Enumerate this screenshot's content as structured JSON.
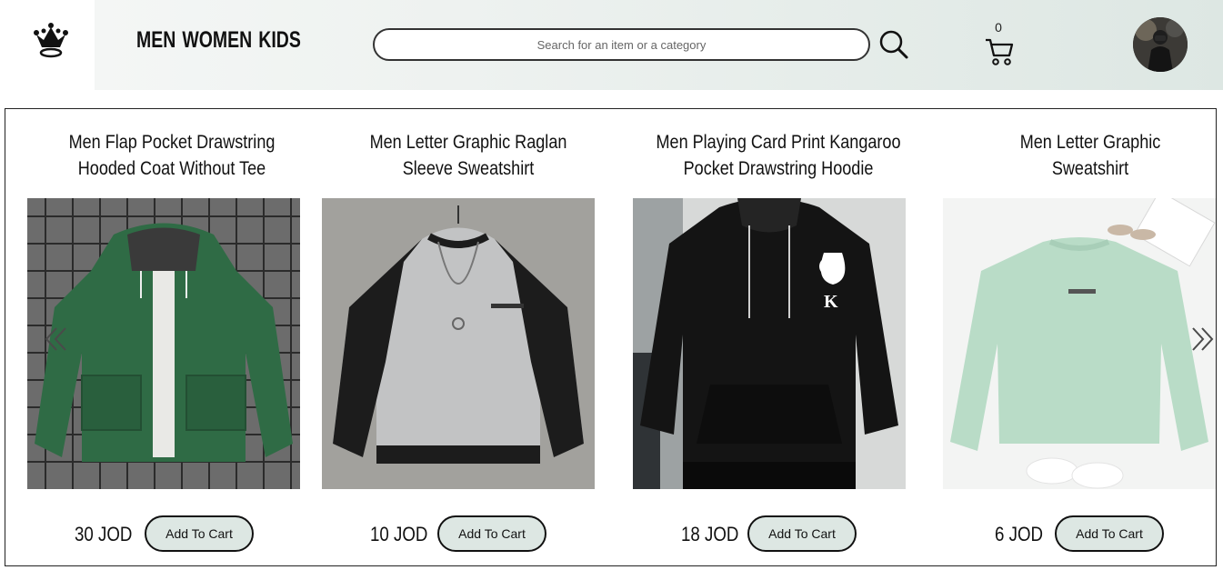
{
  "header": {
    "logo_icon": "crown-icon",
    "nav": [
      "MEN",
      "WOMEN",
      "KIDS"
    ],
    "search": {
      "placeholder": "Search for an item or a category",
      "value": ""
    },
    "search_icon": "search-icon",
    "cart": {
      "count": "0",
      "icon": "cart-icon"
    },
    "avatar_icon": "profile-avatar"
  },
  "carousel": {
    "prev_icon": "chevron-double-left-icon",
    "next_icon": "chevron-double-right-icon",
    "products": [
      {
        "title": "Men Flap Pocket Drawstring Hooded Coat Without Tee",
        "price": "30 JOD",
        "button": "Add To Cart",
        "image": "green-hooded-coat",
        "color": "#2e6e47"
      },
      {
        "title": "Men Letter Graphic Raglan Sleeve Sweatshirt",
        "price": "10 JOD",
        "button": "Add To Cart",
        "image": "grey-black-raglan-sweatshirt",
        "color": "#b9bcbe"
      },
      {
        "title": "Men Playing Card Print Kangaroo Pocket Drawstring Hoodie",
        "price": "18 JOD",
        "button": "Add To Cart",
        "image": "black-hoodie-spade-k",
        "color": "#141414"
      },
      {
        "title": "Men Letter Graphic Sweatshirt",
        "price": "6 JOD",
        "button": "Add To Cart",
        "image": "mint-sweatshirt",
        "color": "#b8dcc6"
      }
    ]
  }
}
